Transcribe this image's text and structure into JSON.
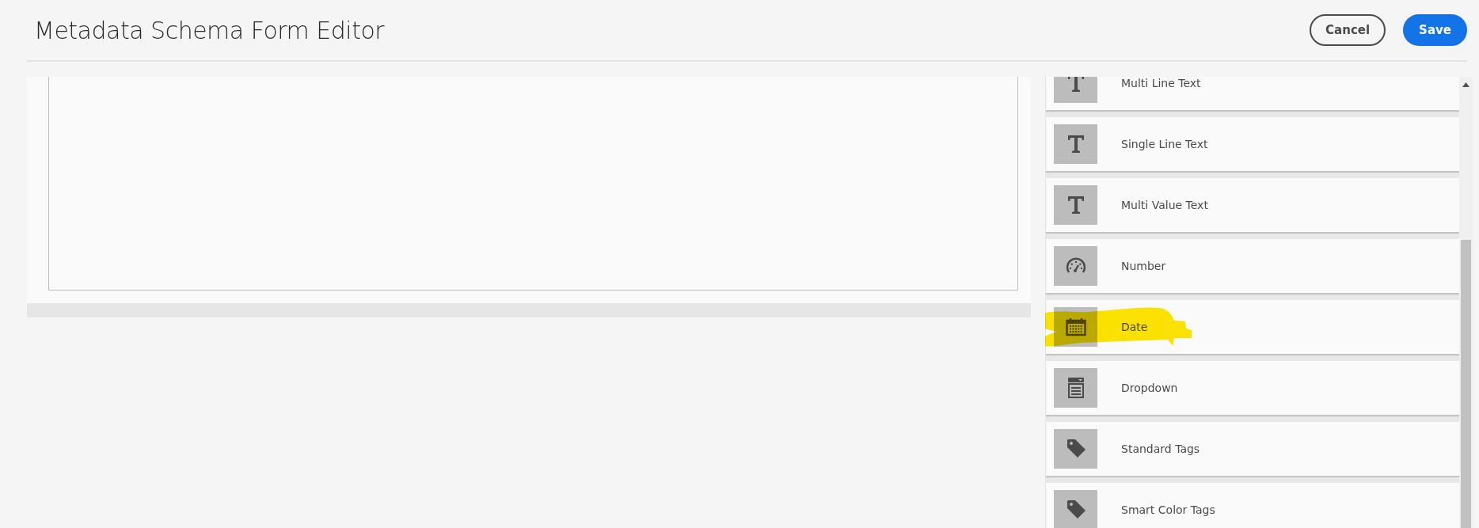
{
  "window": {
    "title": "Metadata Schema Form Editor"
  },
  "buttons": [
    {
      "label": "Cancel",
      "kind": "secondary"
    },
    {
      "label": "Save",
      "kind": "primary"
    }
  ],
  "components": [
    {
      "label": "Multi Line Text",
      "kind": "text",
      "highlighted": false
    },
    {
      "label": "Single Line Text",
      "kind": "text",
      "highlighted": false
    },
    {
      "label": "Multi Value Text",
      "kind": "text",
      "highlighted": false
    },
    {
      "label": "Number",
      "kind": "number",
      "highlighted": false
    },
    {
      "label": "Date",
      "kind": "date",
      "highlighted": true
    },
    {
      "label": "Dropdown",
      "kind": "dropdown",
      "highlighted": false
    },
    {
      "label": "Standard Tags",
      "kind": "tag",
      "highlighted": false
    },
    {
      "label": "Smart Color Tags",
      "kind": "tag",
      "highlighted": false
    }
  ]
}
